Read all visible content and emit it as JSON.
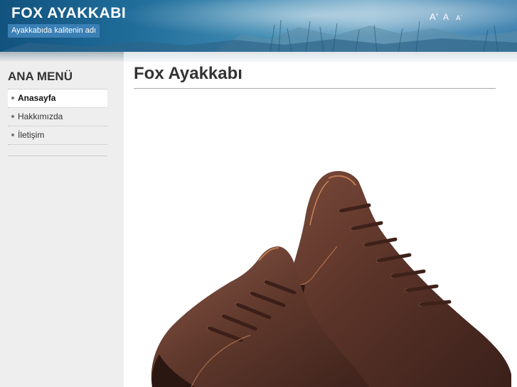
{
  "header": {
    "site_title": "FOX AYAKKABI",
    "slogan": "Ayakkabıda kalitenin adı",
    "font_size_tools": {
      "increase": "A",
      "increase_mark": "+",
      "reset": "A",
      "decrease": "A",
      "decrease_mark": "-"
    }
  },
  "sidebar": {
    "menu_title": "ANA MENÜ",
    "items": [
      {
        "label": "Anasayfa",
        "active": true
      },
      {
        "label": "Hakkımızda",
        "active": false
      },
      {
        "label": "İletişim",
        "active": false
      }
    ]
  },
  "main": {
    "page_title": "Fox Ayakkabı",
    "image": "brown-leather-shoes-image"
  },
  "colors": {
    "header_blue": "#1f6c99",
    "slogan_bg": "#3a80b5",
    "shoe_brown": "#4a2a22"
  }
}
